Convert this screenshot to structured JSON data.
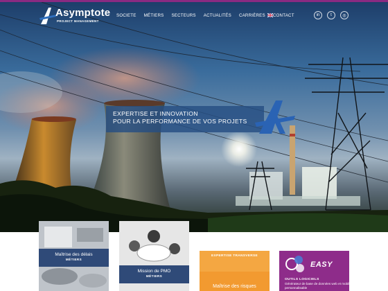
{
  "brand": {
    "name": "Asymptote",
    "subtitle": "PROJECT MANAGEMENT"
  },
  "nav": {
    "items": [
      "SOCIETE",
      "MÉTIERS",
      "SECTEURS",
      "ACTUALITÉS",
      "CARRIÈRES",
      "CONTACT"
    ],
    "language_icon": "uk-flag-icon"
  },
  "social": [
    {
      "icon": "linkedin-icon",
      "glyph": "in"
    },
    {
      "icon": "twitter-icon",
      "glyph": "t"
    },
    {
      "icon": "instagram-icon",
      "glyph": "◎"
    }
  ],
  "hero": {
    "tagline_line1": "EXPERTISE ET INNOVATION",
    "tagline_line2": "POUR LA PERFORMANCE DE VOS PROJETS"
  },
  "cards": [
    {
      "title": "Maîtrise des délais",
      "category": "MÉTIERS"
    },
    {
      "title": "Mission de PMO",
      "category": "MÉTIERS"
    },
    {
      "category": "EXPERTISE TRANSVERSE",
      "title": "Maîtrise des risques"
    },
    {
      "brand": "EASY",
      "category": "OUTILS LOGICIELS",
      "description": "Générateur de base de données web et mobile personnalisable"
    }
  ],
  "colors": {
    "accent_purple": "#8a2a82",
    "navy": "#2f4a78",
    "orange": "#f29a30"
  }
}
